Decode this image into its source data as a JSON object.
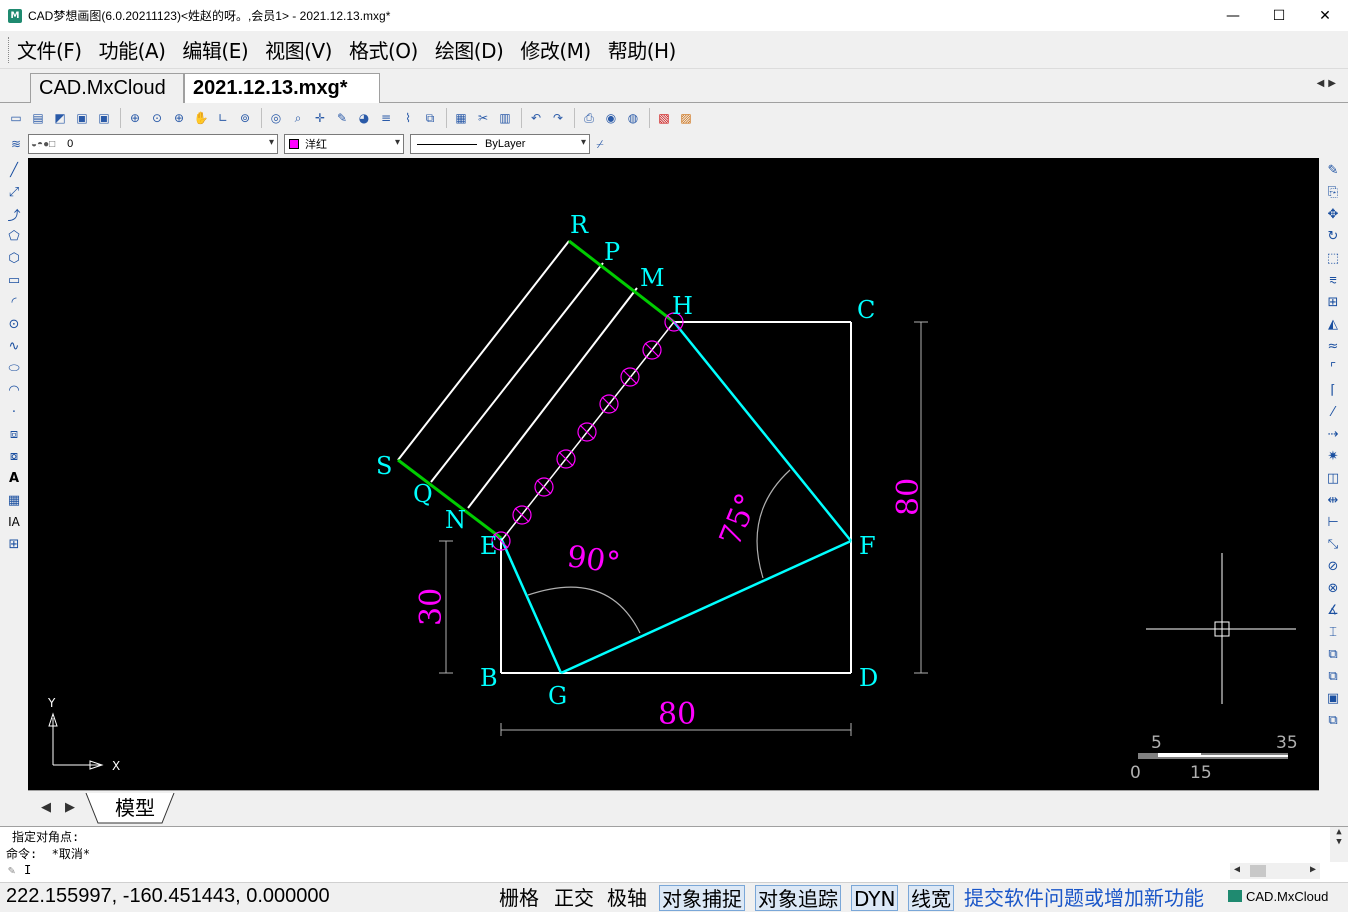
{
  "window": {
    "title": "CAD梦想画图(6.0.20211123)<姓赵的呀。,会员1> - 2021.12.13.mxg*",
    "controls": {
      "minimize": "—",
      "maximize": "☐",
      "close": "✕"
    }
  },
  "menu": {
    "items": [
      "文件(F)",
      "功能(A)",
      "编辑(E)",
      "视图(V)",
      "格式(O)",
      "绘图(D)",
      "修改(M)",
      "帮助(H)"
    ]
  },
  "tabs": [
    {
      "label": "CAD.MxCloud"
    },
    {
      "label": "2021.12.13.mxg*"
    }
  ],
  "props": {
    "layer": "0",
    "color": "洋红",
    "color_hex": "#ff00ff",
    "linetype": "ByLayer"
  },
  "drawing": {
    "points": {
      "R": "R",
      "P": "P",
      "M": "M",
      "H": "H",
      "C": "C",
      "S": "S",
      "Q": "Q",
      "N": "N",
      "E": "E",
      "F": "F",
      "B": "B",
      "G": "G",
      "D": "D"
    },
    "dims": {
      "bottom": "80",
      "right": "80",
      "left": "30"
    },
    "angles": {
      "a90": "90°",
      "a75": "75°"
    },
    "ucs": {
      "x": "X",
      "y": "Y"
    },
    "scale": {
      "top_left": "5",
      "top_right": "35",
      "bottom_left": "0",
      "bottom_mid": "15"
    },
    "colors": {
      "white": "#ffffff",
      "cyan": "#00ffff",
      "green": "#00cc00",
      "magenta": "#ff00ff"
    }
  },
  "sheet": {
    "model_tab": "模型"
  },
  "command": {
    "line1": "指定对角点:",
    "line2": "命令:  *取消*",
    "prompt": "I"
  },
  "status": {
    "coords": "222.155997,  -160.451443,  0.000000",
    "buttons": [
      {
        "label": "栅格",
        "on": false
      },
      {
        "label": "正交",
        "on": false
      },
      {
        "label": "极轴",
        "on": false
      },
      {
        "label": "对象捕捉",
        "on": true
      },
      {
        "label": "对象追踪",
        "on": true
      },
      {
        "label": "DYN",
        "on": true
      },
      {
        "label": "线宽",
        "on": true
      }
    ],
    "feedback": "提交软件问题或增加新功能",
    "brand": "CAD.MxCloud"
  }
}
